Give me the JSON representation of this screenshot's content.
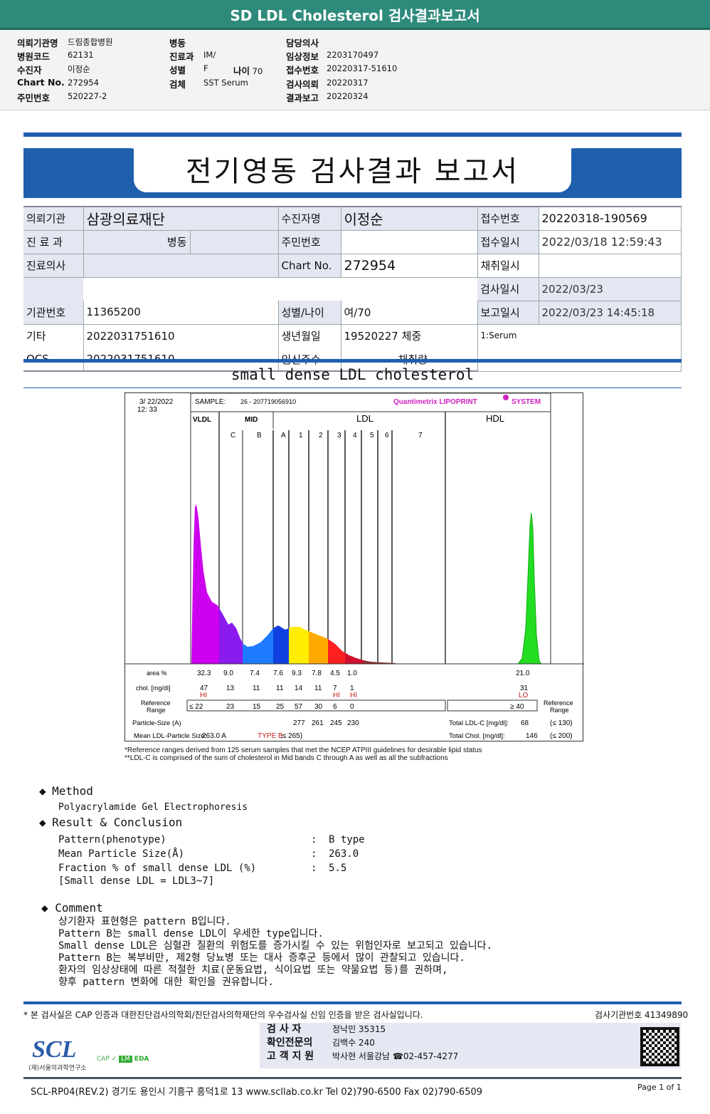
{
  "header": {
    "title": "SD LDL Cholesterol 검사결과보고서"
  },
  "info": {
    "col1": [
      {
        "label": "의뢰기관명",
        "value": "드림종합병원"
      },
      {
        "label": "병원코드",
        "value": "62131"
      },
      {
        "label": "수진자",
        "value": "이정순"
      },
      {
        "label": "Chart No.",
        "value": "272954"
      },
      {
        "label": "주민번호",
        "value": "520227-2"
      }
    ],
    "col2": [
      {
        "label": "병동",
        "value": ""
      },
      {
        "label": "진료과",
        "value": "IM/"
      },
      {
        "label": "성별",
        "value": "F"
      },
      {
        "label": "검체",
        "value": "SST Serum"
      }
    ],
    "age_label": "나이",
    "age_value": "70",
    "col3": [
      {
        "label": "담당의사",
        "value": ""
      },
      {
        "label": "임상정보",
        "value": "2203170497"
      },
      {
        "label": "접수번호",
        "value": "20220317-51610"
      },
      {
        "label": "검사의뢰",
        "value": "20220317"
      },
      {
        "label": "결과보고",
        "value": "20220324"
      }
    ]
  },
  "report": {
    "title": "전기영동 검사결과 보고서"
  },
  "patient": {
    "r1": [
      "의뢰기관",
      "삼광의료재단",
      "수진자명",
      "이정순",
      "접수번호",
      "20220318-190569"
    ],
    "r2": [
      "진 료 과",
      "병동",
      "주민번호",
      "",
      "접수일시",
      "2022/03/18 12:59:43"
    ],
    "r3": [
      "진료의사",
      "",
      "Chart No.",
      "272954",
      "채취일시",
      ""
    ],
    "r3b": [
      "검사일시",
      "2022/03/23"
    ],
    "r4": [
      "기관번호",
      "11365200",
      "성별/나이",
      "여/70",
      "보고일시",
      "2022/03/23 14:45:18"
    ],
    "r5": [
      "기타",
      "2022031751610",
      "생년월일",
      "19520227 체중",
      "1:Serum"
    ],
    "r6": [
      "OCS",
      "2022031751610",
      "임신주수",
      "채취량"
    ]
  },
  "section_title": "small dense LDL cholesterol",
  "chart_data": {
    "type": "area",
    "date": "3/ 22/2022",
    "time": "12: 33",
    "sample_label": "SAMPLE:",
    "sample": "26 - 207719056910",
    "brand": "Quantimetrix LIPOPRINT",
    "brand_suffix": "SYSTEM",
    "groups": [
      "VLDL",
      "MID",
      "LDL",
      "HDL"
    ],
    "bands": [
      "C",
      "B",
      "A",
      "1",
      "2",
      "3",
      "4",
      "5",
      "6",
      "7"
    ],
    "colors": {
      "VLDL": "#cc00ee",
      "C": "#8a1aee",
      "B": "#1e7bff",
      "A": "#1040e0",
      "1": "#ffee00",
      "2": "#ffaa00",
      "3": "#ff2020",
      "4": "#d01030",
      "HDL": "#22dd22"
    },
    "rows": {
      "area_label": "area %",
      "area": [
        "32.3",
        "9.0",
        "7.4",
        "7.6",
        "9.3",
        "7.8",
        "4.5",
        "1.0"
      ],
      "hdl_area": "21.0",
      "chol_label": "chol. [mg/dl]",
      "chol": [
        "47",
        "13",
        "11",
        "11",
        "14",
        "11",
        "7",
        "1"
      ],
      "hdl_chol": "31",
      "flags": [
        "HI",
        "",
        "",
        "",
        "",
        "",
        "HI",
        "HI"
      ],
      "hdl_flag": "LO",
      "ref_label": "Reference Range",
      "ref": [
        "≤ 22",
        "23",
        "15",
        "25",
        "57",
        "30",
        "6",
        "0"
      ],
      "hdl_ref": "≥ 40",
      "size_label": "Particle-Size (A)",
      "sizes": [
        "277",
        "261",
        "245",
        "230"
      ],
      "mean_label": "Mean LDL-Particle Size:",
      "mean_value": "263.0 A",
      "mean_type": "TYPE B",
      "mean_ref": ";≤ 265)",
      "ldlc_label": "Total LDL-C [mg/dl]:",
      "ldlc": "68",
      "ldlc_ref": "(≤ 130)",
      "tchol_label": "Total Chol. [mg/dl]:",
      "tchol": "146",
      "tchol_ref": "(≤ 200)"
    },
    "notes": [
      "*Reference ranges derived from 125 serum samples that met the NCEP ATPIII guidelines for desirable lipid status",
      "**LDL-C is comprised of the sum of cholesterol in Mid bands C through A as well as all the subfractions"
    ]
  },
  "method": {
    "title": "Method",
    "text": "Polyacrylamide Gel Electrophoresis"
  },
  "result": {
    "title": "Result & Conclusion",
    "items": [
      {
        "label": "Pattern(phenotype)",
        "value": "B type"
      },
      {
        "label": "Mean Particle Size(Å)",
        "value": "263.0"
      },
      {
        "label": "Fraction % of small dense LDL (%)",
        "value": "5.5"
      }
    ],
    "note": "[Small dense LDL = LDL3~7]"
  },
  "comment": {
    "title": "Comment",
    "lines": [
      "상기환자 표현형은 pattern B입니다.",
      "Pattern B는 small dense LDL이 우세한 type입니다.",
      "Small dense LDL은 심혈관 질환의 위험도를 증가시킬 수 있는 위험인자로 보고되고 있습니다.",
      "Pattern B는 복부비만, 제2형 당뇨병 또는 대사 증후군 등에서 많이 관찰되고 있습니다.",
      "환자의 임상상태에 따른 적절한 치료(운동요법, 식이요법 또는 약물요법 등)를 권하며,",
      "향후 pattern 변화에 대한 확인을 권유합니다."
    ]
  },
  "footer": {
    "cert": "* 본 검사실은 CAP 인증과 대한진단검사의학회/진단검사의학재단의 우수검사실 신임 인증을 받은 검사실입니다.",
    "lab_no": "검사기관번호 41349890",
    "staff": [
      {
        "role": "검 사 자",
        "name": "정낙민 35315"
      },
      {
        "role": "확인전문의",
        "name": "김백수 240"
      },
      {
        "role": "고 객 지 원",
        "name": "박사현 서울강남 ☎02-457-4277"
      }
    ],
    "logo": "SCL",
    "logo_sub": "(재)서울의과학연구소",
    "address": "SCL-RP04(REV.2)  경기도 용인시 기흥구 흥덕1로 13  www.scllab.co.kr  Tel 02)790-6500  Fax 02)790-6509",
    "page": "Page 1 of 1"
  }
}
